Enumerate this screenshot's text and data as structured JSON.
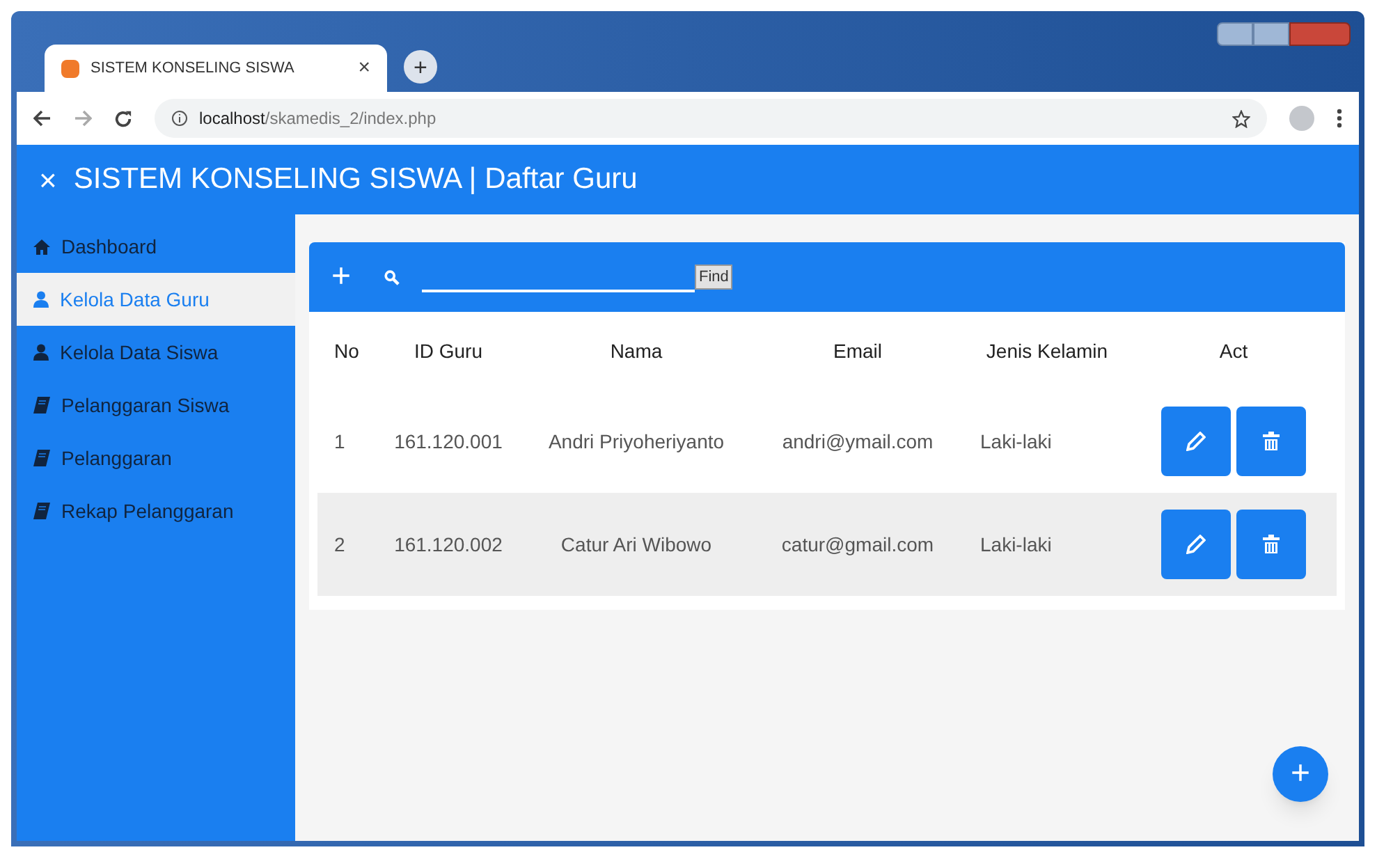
{
  "browser": {
    "tab_title": "SISTEM KONSELING SISWA",
    "tab_close": "×",
    "new_tab": "+",
    "url_host": "localhost",
    "url_path": "/skamedis_2/index.php"
  },
  "header": {
    "close": "×",
    "title": "SISTEM KONSELING SISWA | Daftar Guru"
  },
  "sidebar": {
    "items": [
      {
        "label": "Dashboard",
        "kind": "home",
        "selected": false
      },
      {
        "label": "Kelola Data Guru",
        "kind": "user",
        "selected": true
      },
      {
        "label": "Kelola Data Siswa",
        "kind": "user",
        "selected": false
      },
      {
        "label": "Pelanggaran Siswa",
        "kind": "book",
        "selected": false
      },
      {
        "label": "Pelanggaran",
        "kind": "book",
        "selected": false
      },
      {
        "label": "Rekap Pelanggaran",
        "kind": "book",
        "selected": false
      }
    ]
  },
  "toolbar": {
    "add": "+",
    "find_button": "Find"
  },
  "table": {
    "columns": [
      "No",
      "ID Guru",
      "Nama",
      "Email",
      "Jenis Kelamin",
      "Act"
    ],
    "rows": [
      {
        "no": "1",
        "id": "161.120.001",
        "nama": "Andri Priyoheriyanto",
        "email": "andri@ymail.com",
        "gender": "Laki-laki"
      },
      {
        "no": "2",
        "id": "161.120.002",
        "nama": "Catur Ari Wibowo",
        "email": "catur@gmail.com",
        "gender": "Laki-laki"
      }
    ]
  },
  "fab": "+"
}
